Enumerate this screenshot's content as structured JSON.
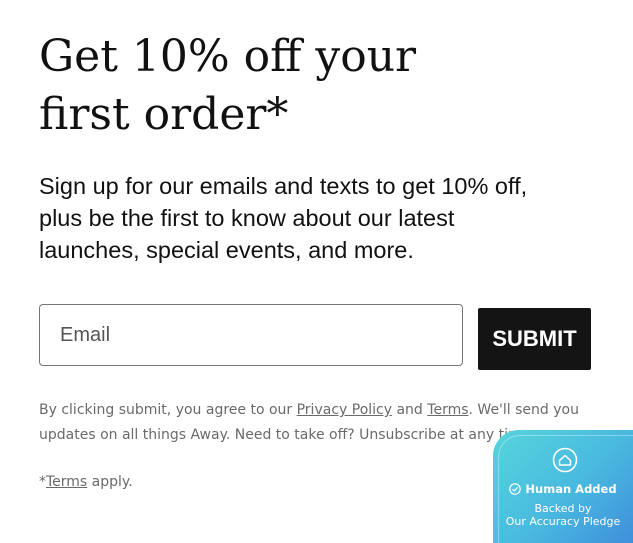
{
  "headline": {
    "line1": "Get 10% off your",
    "line2": "first order*"
  },
  "subtext": {
    "line1": "Sign up for our emails and texts to get 10% off,",
    "line2": "plus be the first to know about our latest",
    "line3": "launches, special events, and more."
  },
  "form": {
    "email_placeholder": "Email",
    "email_value": "",
    "submit_label": "SUBMIT"
  },
  "disclaimer": {
    "prefix": "By clicking submit, you agree to our ",
    "privacy_link": "Privacy Policy",
    "and": " and ",
    "terms_link": "Terms",
    "suffix": ". We'll send you updates on all things Away. Need to take off? Unsubscribe at any time."
  },
  "footnote": {
    "prefix": "*",
    "terms_link": "Terms",
    "suffix": " apply."
  },
  "badge": {
    "title": "Human Added",
    "line1": "Backed by",
    "line2": "Our Accuracy Pledge",
    "logo_icon": "house-icon",
    "check_icon": "check-circle-icon"
  },
  "colors": {
    "text": "#111111",
    "muted": "#6a6a6a",
    "button_bg": "#141414",
    "badge_gradient_start": "#56d5dc",
    "badge_gradient_end": "#3f8fdb"
  }
}
